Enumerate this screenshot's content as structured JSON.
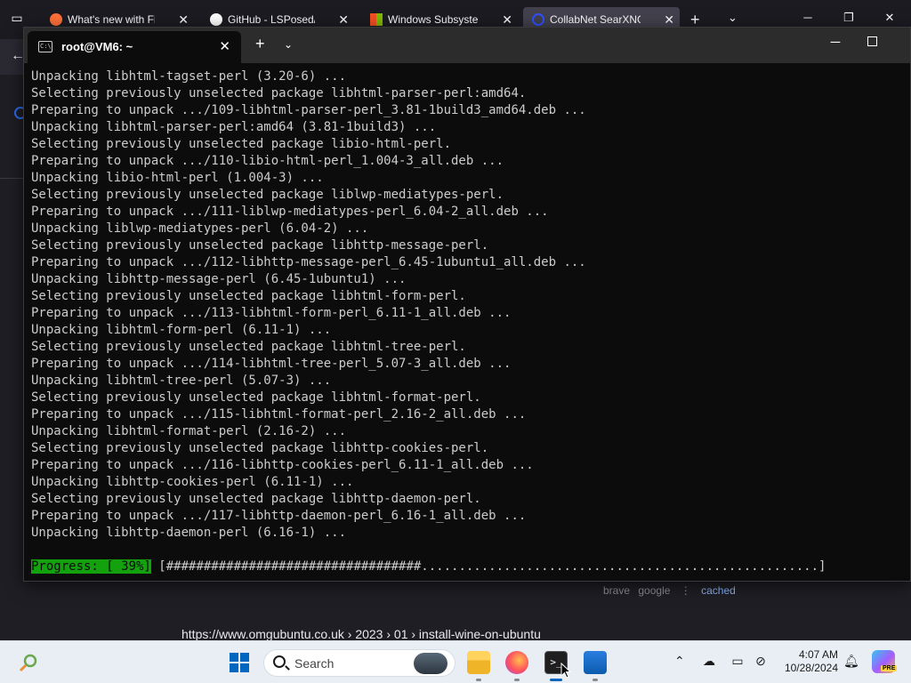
{
  "browser": {
    "tabs": [
      {
        "title": "What's new with Firefox",
        "favicon_color": "#ff7139"
      },
      {
        "title": "GitHub - LSPosed/MagiskOnWSA",
        "favicon_color": "#ffffff"
      },
      {
        "title": "Windows Subsystem for Android",
        "favicon_color": "#f25022"
      },
      {
        "title": "CollabNet SearXNG",
        "favicon_color": "#3050ff"
      }
    ],
    "results": {
      "engines": [
        "brave",
        "google"
      ],
      "cached_label": "cached",
      "url": "https://www.omgubuntu.co.uk  › 2023 › 01 › install-wine-on-ubuntu"
    }
  },
  "terminal": {
    "title": "root@VM6: ~",
    "lines": [
      "Unpacking libhtml-tagset-perl (3.20-6) ...",
      "Selecting previously unselected package libhtml-parser-perl:amd64.",
      "Preparing to unpack .../109-libhtml-parser-perl_3.81-1build3_amd64.deb ...",
      "Unpacking libhtml-parser-perl:amd64 (3.81-1build3) ...",
      "Selecting previously unselected package libio-html-perl.",
      "Preparing to unpack .../110-libio-html-perl_1.004-3_all.deb ...",
      "Unpacking libio-html-perl (1.004-3) ...",
      "Selecting previously unselected package liblwp-mediatypes-perl.",
      "Preparing to unpack .../111-liblwp-mediatypes-perl_6.04-2_all.deb ...",
      "Unpacking liblwp-mediatypes-perl (6.04-2) ...",
      "Selecting previously unselected package libhttp-message-perl.",
      "Preparing to unpack .../112-libhttp-message-perl_6.45-1ubuntu1_all.deb ...",
      "Unpacking libhttp-message-perl (6.45-1ubuntu1) ...",
      "Selecting previously unselected package libhtml-form-perl.",
      "Preparing to unpack .../113-libhtml-form-perl_6.11-1_all.deb ...",
      "Unpacking libhtml-form-perl (6.11-1) ...",
      "Selecting previously unselected package libhtml-tree-perl.",
      "Preparing to unpack .../114-libhtml-tree-perl_5.07-3_all.deb ...",
      "Unpacking libhtml-tree-perl (5.07-3) ...",
      "Selecting previously unselected package libhtml-format-perl.",
      "Preparing to unpack .../115-libhtml-format-perl_2.16-2_all.deb ...",
      "Unpacking libhtml-format-perl (2.16-2) ...",
      "Selecting previously unselected package libhttp-cookies-perl.",
      "Preparing to unpack .../116-libhttp-cookies-perl_6.11-1_all.deb ...",
      "Unpacking libhttp-cookies-perl (6.11-1) ...",
      "Selecting previously unselected package libhttp-daemon-perl.",
      "Preparing to unpack .../117-libhttp-daemon-perl_6.16-1_all.deb ...",
      "Unpacking libhttp-daemon-perl (6.16-1) ..."
    ],
    "progress": {
      "label": "Progress: [ 39%]",
      "bar": "[##################################.....................................................]",
      "percent": 39
    }
  },
  "taskbar": {
    "search_placeholder": "Search",
    "time": "4:07 AM",
    "date": "10/28/2024",
    "pinned_apps": [
      "file-explorer",
      "firefox",
      "terminal",
      "microsoft-store"
    ],
    "accent_color": "#0067c0"
  }
}
